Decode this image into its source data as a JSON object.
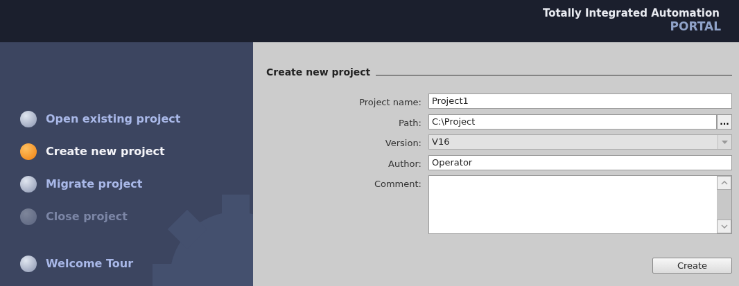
{
  "header": {
    "title": "Totally Integrated Automation",
    "subtitle": "PORTAL"
  },
  "sidebar": {
    "items": [
      {
        "label": "Open existing project",
        "selected": false,
        "disabled": false
      },
      {
        "label": "Create new project",
        "selected": true,
        "disabled": false
      },
      {
        "label": "Migrate project",
        "selected": false,
        "disabled": false
      },
      {
        "label": "Close project",
        "selected": false,
        "disabled": true
      },
      {
        "label": "Welcome Tour",
        "selected": false,
        "disabled": false
      }
    ]
  },
  "form": {
    "title": "Create new project",
    "fields": [
      {
        "label": "Project name:",
        "kind": "text",
        "value": "Project1"
      },
      {
        "label": "Path:",
        "kind": "browse",
        "value": "C:\\Project",
        "button": "..."
      },
      {
        "label": "Version:",
        "kind": "dropdown",
        "value": "V16"
      },
      {
        "label": "Author:",
        "kind": "text",
        "value": "Operator"
      },
      {
        "label": "Comment:",
        "kind": "textarea"
      }
    ],
    "button": "Create"
  }
}
